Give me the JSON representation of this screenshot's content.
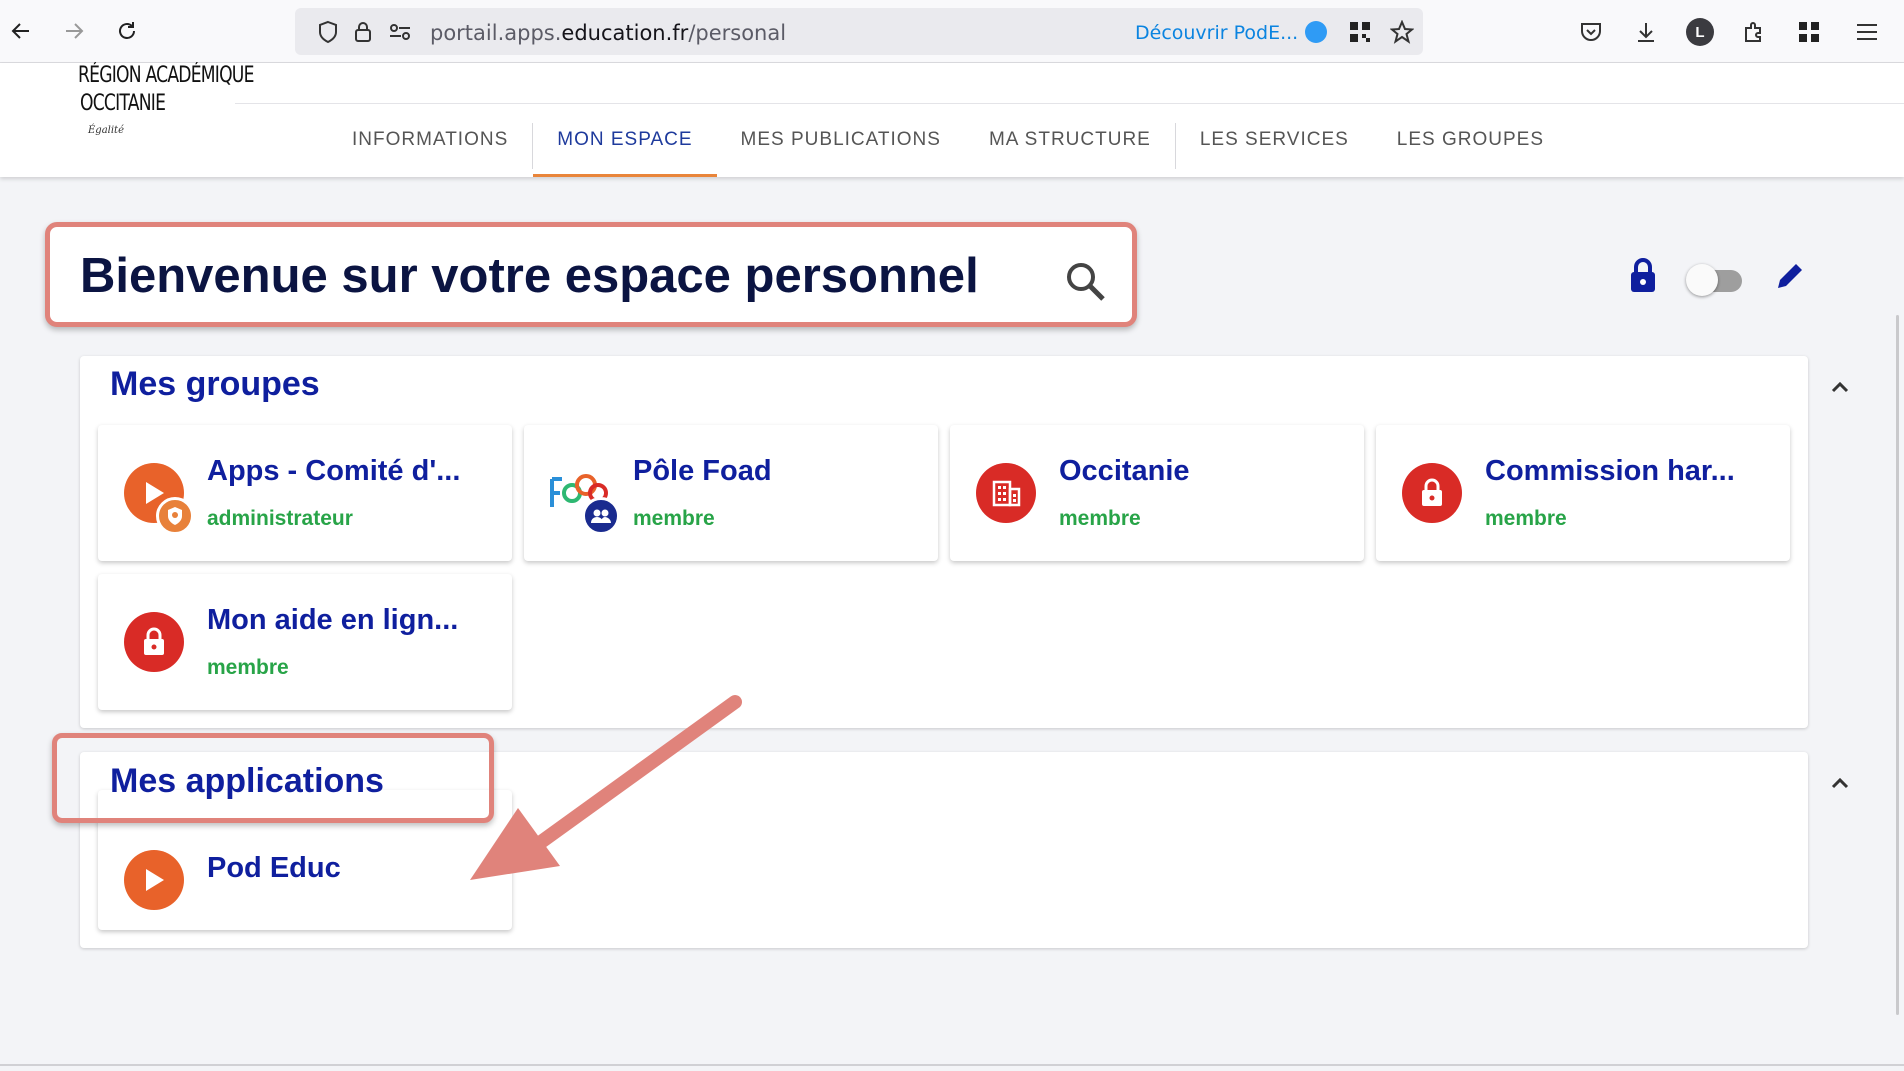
{
  "browser": {
    "url_prefix": "portail.apps.",
    "url_domain": "education.fr",
    "url_path": "/personal",
    "discover_label": "Découvrir PodE...",
    "account_initial": "L"
  },
  "logo": {
    "line1": "RÉGION ACADÉMIQUE",
    "line2": "OCCITANIE",
    "line3": "Égalité"
  },
  "nav": {
    "tabs": [
      "INFORMATIONS",
      "MON ESPACE",
      "MES PUBLICATIONS",
      "MA STRUCTURE",
      "LES SERVICES",
      "LES GROUPES"
    ],
    "active": "MON ESPACE"
  },
  "page": {
    "welcome": "Bienvenue sur votre espace personnel"
  },
  "groups": {
    "title": "Mes groupes",
    "items": [
      {
        "name": "Apps - Comité d'...",
        "role": "administrateur"
      },
      {
        "name": "Pôle Foad",
        "role": "membre"
      },
      {
        "name": "Occitanie",
        "role": "membre"
      },
      {
        "name": "Commission har...",
        "role": "membre"
      },
      {
        "name": "Mon aide en lign...",
        "role": "membre"
      }
    ]
  },
  "applications": {
    "title": "Mes applications",
    "items": [
      {
        "name": "Pod Educ"
      }
    ]
  },
  "colors": {
    "accent": "#0f1f9e",
    "role_green": "#28a448",
    "highlight": "#e0837b",
    "active_tab_underline": "#e9853a"
  }
}
